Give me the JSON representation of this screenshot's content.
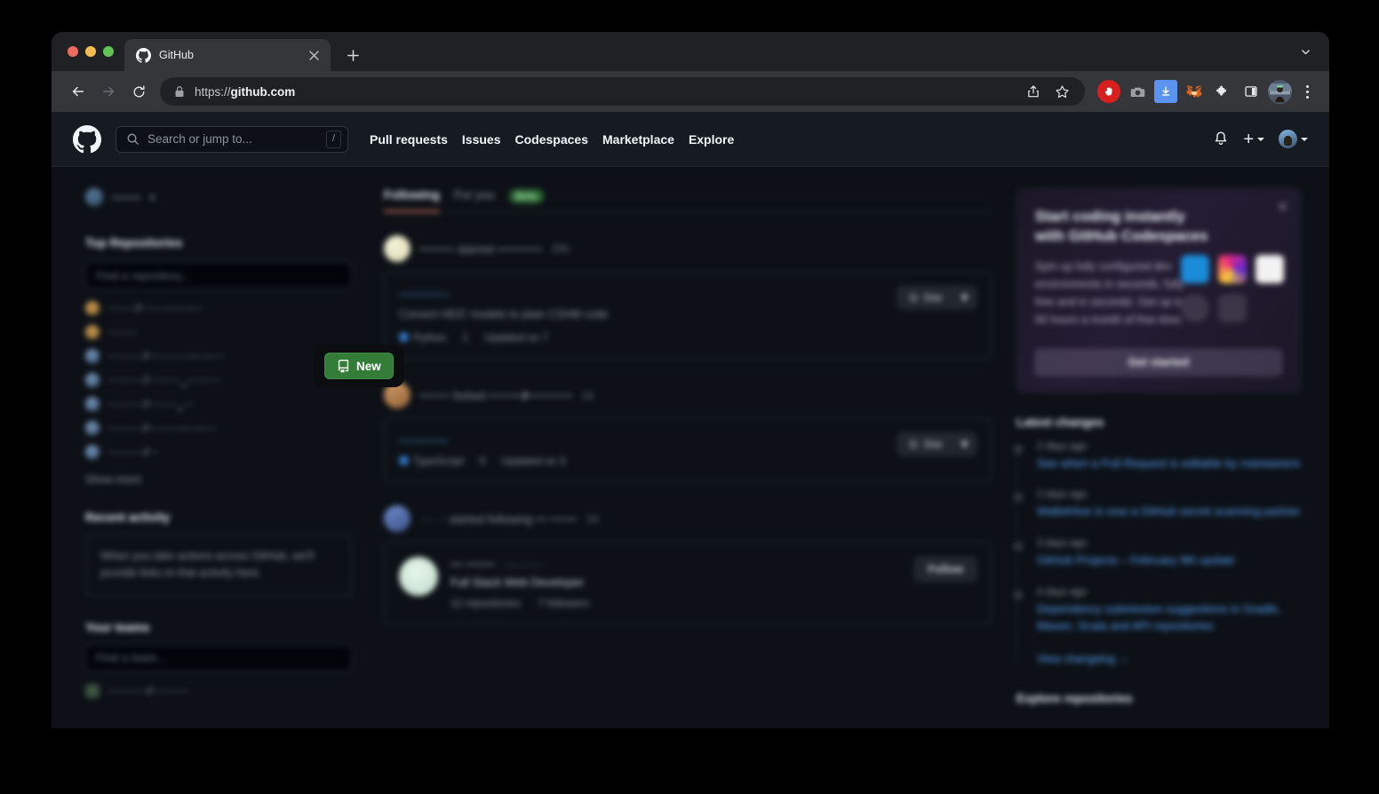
{
  "browser": {
    "traffic_lights": [
      "close",
      "minimize",
      "zoom"
    ],
    "tab": {
      "title": "GitHub",
      "favicon": "github-icon",
      "close_label": "×"
    },
    "new_tab_label": "+",
    "tab_list_icon": "chevron-down-icon",
    "nav": {
      "back": "back-arrow-icon",
      "forward": "forward-arrow-icon",
      "reload": "reload-icon"
    },
    "omnibox": {
      "lock": "lock-icon",
      "url_scheme": "https://",
      "url_host": "github.com",
      "share_icon": "share-icon",
      "bookmark_icon": "star-outline-icon"
    },
    "extensions": [
      {
        "name": "adblock-icon",
        "color": "#d9201f"
      },
      {
        "name": "camera-icon",
        "color": "#9aa0a6"
      },
      {
        "name": "download-icon",
        "color": "#5a94f0"
      },
      {
        "name": "metamask-fox-icon",
        "color": "#e2761b"
      },
      {
        "name": "puzzle-extensions-icon",
        "color": "#e8eaed"
      },
      {
        "name": "sidebar-panel-icon",
        "color": "#e8eaed"
      }
    ],
    "profile_icon": "browser-profile-avatar",
    "menu_icon": "kebab-menu-icon"
  },
  "github": {
    "header": {
      "logo": "github-mark-icon",
      "search": {
        "placeholder": "Search or jump to...",
        "shortcut_key": "/",
        "icon": "search-icon"
      },
      "nav": [
        {
          "label": "Pull requests"
        },
        {
          "label": "Issues"
        },
        {
          "label": "Codespaces"
        },
        {
          "label": "Marketplace"
        },
        {
          "label": "Explore"
        }
      ],
      "notifications_icon": "bell-icon",
      "create_new_icon": "plus-icon",
      "avatar": "user-avatar"
    },
    "sidebar": {
      "username": "·······",
      "top_repositories_title": "Top Repositories",
      "new_button": {
        "label": "New",
        "icon": "repo-icon",
        "color": "#347d39"
      },
      "repo_filter_placeholder": "Find a repository...",
      "repositories": [
        {
          "name": "········/········-····-···",
          "color": "amber"
        },
        {
          "name": "········",
          "color": "amber"
        },
        {
          "name": "··········/············-···-····",
          "color": "blue"
        },
        {
          "name": "··········/·········_·········",
          "color": "blue"
        },
        {
          "name": "··········/········_···",
          "color": "blue"
        },
        {
          "name": "··········/··········-···-····",
          "color": "blue"
        },
        {
          "name": "··········/···",
          "color": "blue"
        }
      ],
      "show_more_label": "Show more",
      "recent_activity_title": "Recent activity",
      "recent_activity_empty": "When you take actions across GitHub, we'll provide links to that activity here.",
      "your_teams_title": "Your teams",
      "team_filter_placeholder": "Find a team...",
      "teams": [
        {
          "name": "···········/··········"
        }
      ]
    },
    "feed": {
      "tabs": [
        {
          "label": "Following",
          "active": true
        },
        {
          "label": "For you",
          "active": false
        }
      ],
      "beta_badge": "Beta",
      "items": [
        {
          "type": "starred-repo",
          "avatar": "cream",
          "actor": "·········",
          "action": "starred",
          "target": "············",
          "time": "20h",
          "repo_name": "············",
          "repo_desc": "Convert HEIC models to plain CSHM code",
          "language": "Python",
          "stars": "1",
          "updated": "Updated on 7",
          "star_button": "Star",
          "star_caret": "chevron-down-icon"
        },
        {
          "type": "forked-repo",
          "avatar": "tan",
          "actor": "········",
          "action": "forked",
          "target": "·········/············",
          "time": "1d",
          "repo_name": "············",
          "repo_desc": "",
          "language": "TypeScript",
          "stars": "0",
          "updated": "Updated on 3",
          "star_button": "Star",
          "star_caret": "chevron-down-icon"
        },
        {
          "type": "followed-user",
          "avatar": "blue",
          "actor": "···· ··",
          "action": "started following",
          "target": "··· ·······",
          "time": "1d",
          "person_name": "··· ·······",
          "person_handle": "··-·······",
          "person_bio": "Full Stack Web Developer",
          "person_repos": "12 repositories",
          "person_followers": "7 followers",
          "follow_button": "Follow"
        }
      ]
    },
    "right_rail": {
      "promo": {
        "title": "Start coding instantly with GitHub Codespaces",
        "body": "Spin up fully configured dev environments in seconds, fully free and in seconds. Get up to 60 hours a month of free time.",
        "cta": "Get started",
        "close_icon": "close-icon"
      },
      "latest_changes_title": "Latest changes",
      "changes": [
        {
          "time": "2 days ago",
          "title": "See when a Pull Request is editable by maintainers"
        },
        {
          "time": "2 days ago",
          "title": "WalletHive is now a GitHub secret scanning partner"
        },
        {
          "time": "3 days ago",
          "title": "GitHub Projects – February 9th update"
        },
        {
          "time": "4 days ago",
          "title": "Dependency submission suggestions in Gradle, Maven, Scala and API repositories"
        }
      ],
      "changelog_link": "View changelog →",
      "explore_title": "Explore repositories"
    }
  }
}
